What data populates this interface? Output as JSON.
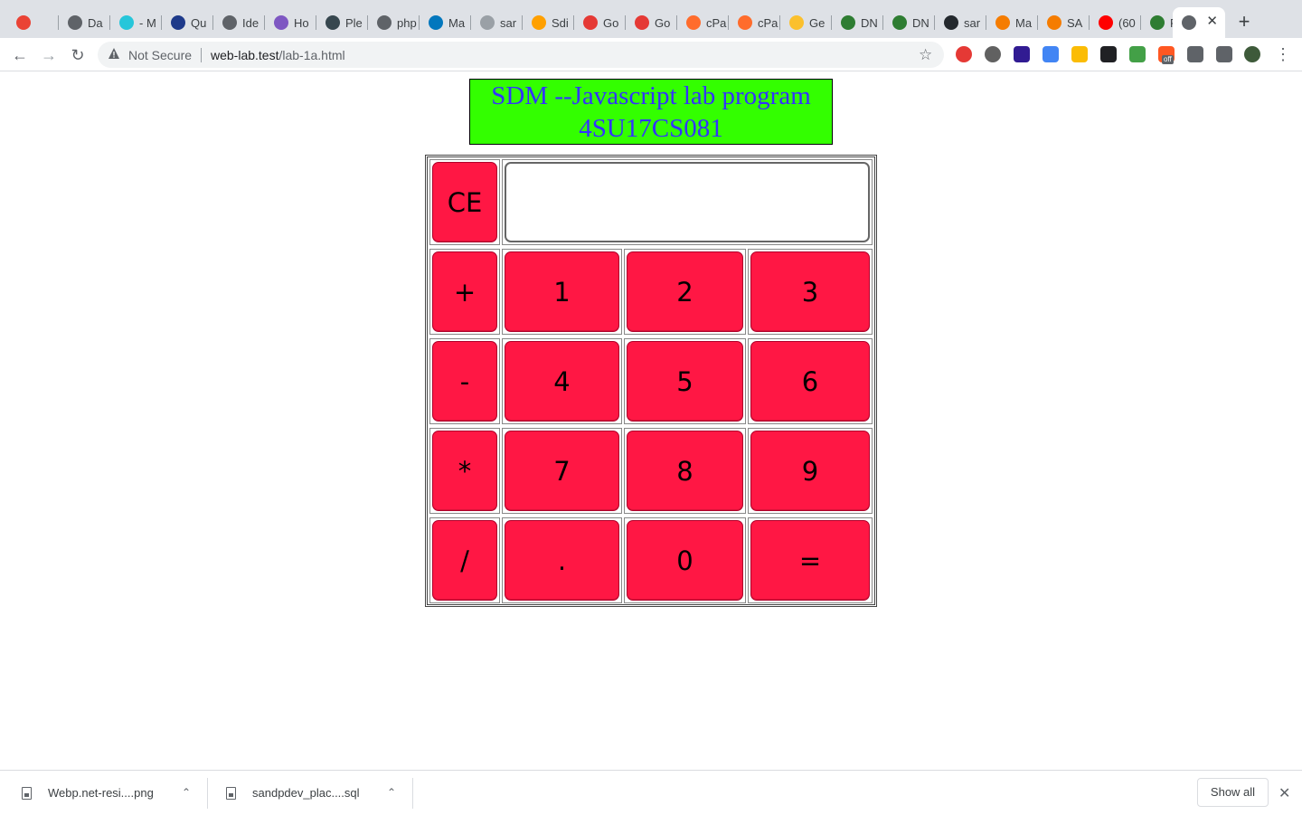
{
  "browser": {
    "tabs": [
      {
        "title": "",
        "icon": "gmail-icon",
        "color": "#ea4335"
      },
      {
        "title": "Da",
        "icon": "play-icon",
        "color": "#5f6368"
      },
      {
        "title": "- M",
        "icon": "spiral-icon",
        "color": "#26c6da"
      },
      {
        "title": "Qu",
        "icon": "q-icon",
        "color": "#1e3a8a"
      },
      {
        "title": "Ide",
        "icon": "globe-icon",
        "color": "#5f6368"
      },
      {
        "title": "Ho",
        "icon": "arrow-icon",
        "color": "#7e57c2"
      },
      {
        "title": "Ple",
        "icon": "p-icon",
        "color": "#37474f"
      },
      {
        "title": "php",
        "icon": "globe-icon",
        "color": "#5f6368"
      },
      {
        "title": "Ma",
        "icon": "video-icon",
        "color": "#0277bd"
      },
      {
        "title": "sar",
        "icon": "github-icon",
        "color": "#9aa0a6"
      },
      {
        "title": "Sdi",
        "icon": "firebase-icon",
        "color": "#ffa000"
      },
      {
        "title": "Go",
        "icon": "google-icon",
        "color": "#e53935"
      },
      {
        "title": "Go",
        "icon": "google-icon",
        "color": "#e53935"
      },
      {
        "title": "cPa",
        "icon": "cpanel-icon",
        "color": "#ff6c2c"
      },
      {
        "title": "cPa",
        "icon": "cpanel-icon",
        "color": "#ff6c2c"
      },
      {
        "title": "Ge",
        "icon": "hand-icon",
        "color": "#fbc02d"
      },
      {
        "title": "DN",
        "icon": "dns-icon",
        "color": "#2e7d32"
      },
      {
        "title": "DN",
        "icon": "dns-icon",
        "color": "#2e7d32"
      },
      {
        "title": "sar",
        "icon": "github-icon",
        "color": "#24292e"
      },
      {
        "title": "Ma",
        "icon": "loader-icon",
        "color": "#f57c00"
      },
      {
        "title": "SA",
        "icon": "book-icon",
        "color": "#f57c00"
      },
      {
        "title": "(60",
        "icon": "youtube-icon",
        "color": "#ff0000"
      },
      {
        "title": "Ro",
        "icon": "link-icon",
        "color": "#2e7d32"
      }
    ],
    "active_tab": {
      "title": "",
      "icon": "globe-icon",
      "close_label": "✕"
    },
    "new_tab_label": "+",
    "security_label": "Not Secure",
    "url_host": "web-lab.test",
    "url_path": "/lab-1a.html",
    "extensions": [
      {
        "icon": "adblock-icon",
        "color": "#e53935"
      },
      {
        "icon": "settings-ext-icon",
        "color": "#616161"
      },
      {
        "icon": "layers-icon",
        "color": "#311b92"
      },
      {
        "icon": "translate-icon",
        "color": "#4285f4"
      },
      {
        "icon": "drive-icon",
        "color": "#fbbc05"
      },
      {
        "icon": "grid-icon",
        "color": "#202124"
      },
      {
        "icon": "pen-icon",
        "color": "#43a047"
      },
      {
        "icon": "off-ext-icon",
        "color": "#ff5722"
      },
      {
        "icon": "puzzle-icon",
        "color": "#5f6368"
      },
      {
        "icon": "media-icon",
        "color": "#5f6368"
      },
      {
        "icon": "profile-avatar-icon",
        "color": "#3e5a3a"
      }
    ],
    "off_badge": "off"
  },
  "page": {
    "heading_line1": "SDM --Javascript lab program",
    "heading_line2": "4SU17CS081",
    "display_value": "",
    "clear_label": "CE",
    "rows": [
      [
        "+",
        "1",
        "2",
        "3"
      ],
      [
        "-",
        "4",
        "5",
        "6"
      ],
      [
        "*",
        "7",
        "8",
        "9"
      ],
      [
        "/",
        ".",
        "0",
        "="
      ]
    ],
    "colors": {
      "heading_bg": "#33ff00",
      "heading_text": "#3333ff",
      "key": "#ff1744"
    }
  },
  "downloads": {
    "items": [
      {
        "name": "Webp.net-resi....png"
      },
      {
        "name": "sandpdev_plac....sql"
      }
    ],
    "show_all_label": "Show all",
    "close_label": "✕"
  }
}
